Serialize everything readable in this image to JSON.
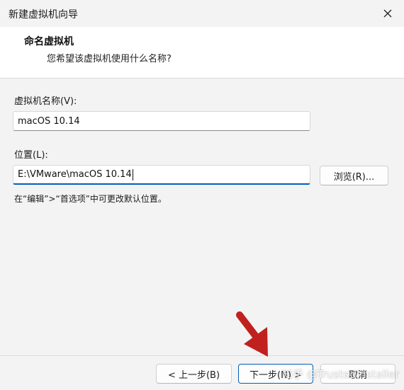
{
  "window": {
    "title": "新建虚拟机向导"
  },
  "header": {
    "title": "命名虚拟机",
    "subtitle": "您希望该虚拟机使用什么名称?"
  },
  "form": {
    "name_label": "虚拟机名称(V):",
    "name_value": "macOS 10.14",
    "location_label": "位置(L):",
    "location_value": "E:\\VMware\\macOS 10.14",
    "browse_label": "浏览(R)...",
    "hint": "在“编辑”>“首选项”中可更改默认位置。"
  },
  "footer": {
    "back_label": "< 上一步(B)",
    "next_label": "下一步(N) >",
    "cancel_label": "取消"
  },
  "overlay": {
    "watermark": "知乎 @TrustedInstaller",
    "arrow_color": "#c0211f"
  },
  "colors": {
    "accent": "#005fb8",
    "background": "#f3f3f3"
  }
}
